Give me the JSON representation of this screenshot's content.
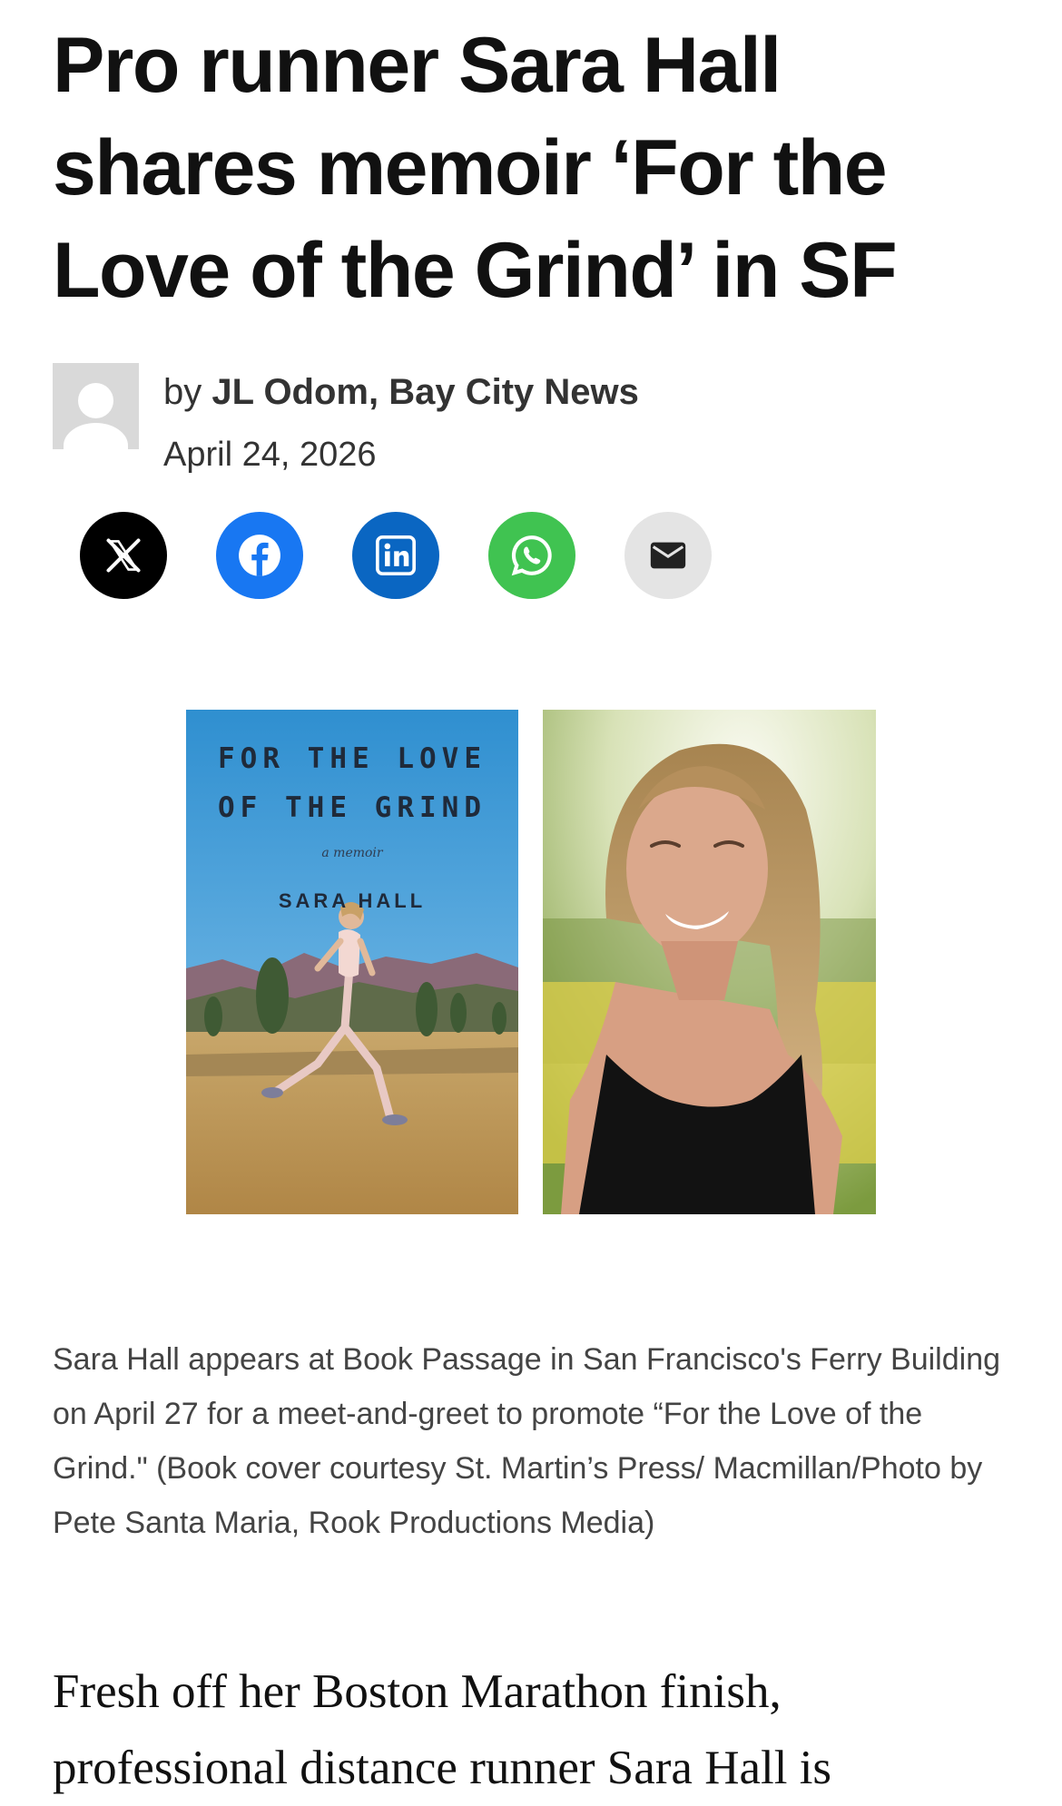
{
  "article": {
    "headline": "Pro runner Sara Hall shares memoir ‘For the Love of the Grind’ in SF",
    "byline_prefix": "by",
    "author": "JL Odom, Bay City News",
    "date": "April 24, 2026",
    "share_buttons": [
      {
        "icon": "x-icon",
        "color": "#000000"
      },
      {
        "icon": "facebook-icon",
        "color": "#1877f2"
      },
      {
        "icon": "linkedin-icon",
        "color": "#0a66c2"
      },
      {
        "icon": "whatsapp-icon",
        "color": "#40c351"
      },
      {
        "icon": "email-icon",
        "color": "#e4e4e4"
      }
    ],
    "image": {
      "cover": {
        "title_line1": "FOR THE LOVE",
        "title_line2": "OF THE GRIND",
        "subtitle": "a memoir",
        "author": "SARA HALL"
      }
    },
    "caption": "Sara Hall appears at Book Passage in San Francisco's Ferry Building on April 27 for a meet-and-greet to promote “For the Love of the Grind.\" (Book cover courtesy St. Martin’s Press/ Macmillan/Photo by Pete Santa Maria, Rook Productions Media)",
    "body_start": "Fresh off her Boston Marathon finish, professional distance runner Sara Hall is"
  }
}
